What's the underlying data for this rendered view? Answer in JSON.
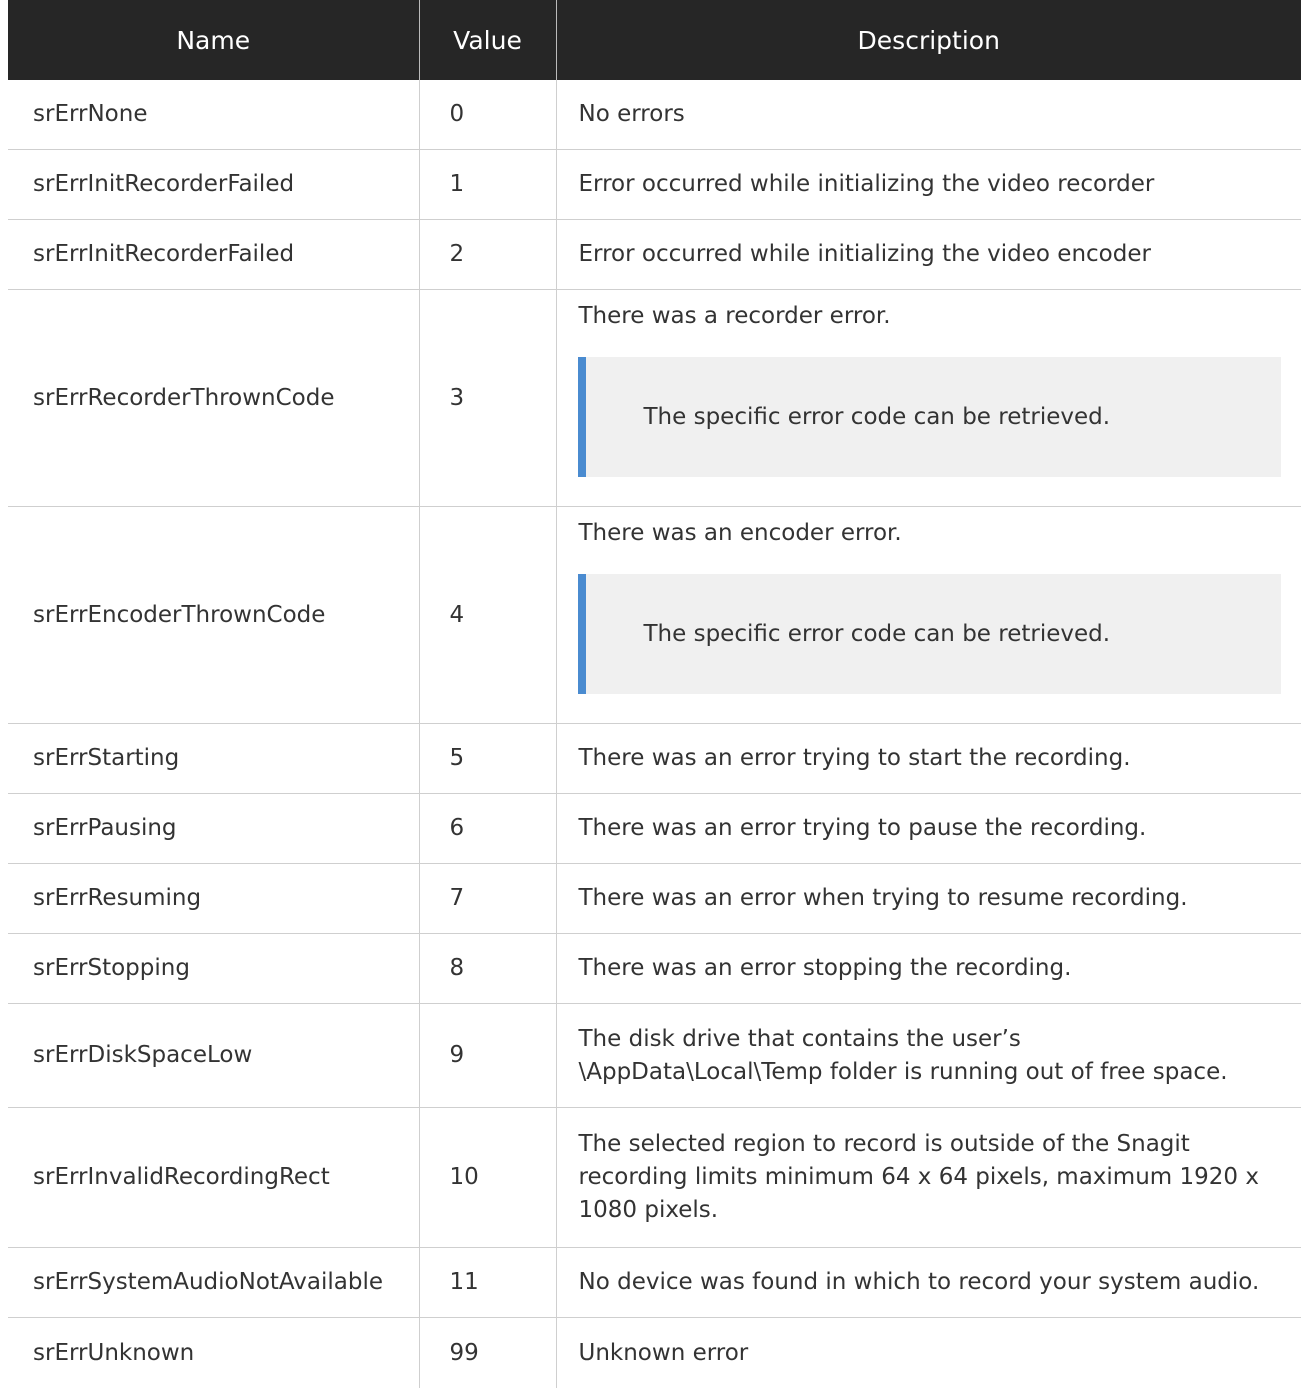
{
  "columns": [
    "Name",
    "Value",
    "Description"
  ],
  "rows": [
    {
      "name": "srErrNone",
      "value": "0",
      "description": "No errors"
    },
    {
      "name": "srErrInitRecorderFailed",
      "value": "1",
      "description": "Error occurred while initializing the video recorder"
    },
    {
      "name": "srErrInitRecorderFailed",
      "value": "2",
      "description": "Error occurred while initializing the video encoder"
    },
    {
      "name": "srErrRecorderThrownCode",
      "value": "3",
      "description": "There was a recorder error.",
      "note": "The specific error code can be retrieved."
    },
    {
      "name": "srErrEncoderThrownCode",
      "value": "4",
      "description": "There was an encoder error.",
      "note": "The specific error code can be retrieved."
    },
    {
      "name": "srErrStarting",
      "value": "5",
      "description": "There was an error trying to start the recording."
    },
    {
      "name": "srErrPausing",
      "value": "6",
      "description": "There was an error trying to pause the recording."
    },
    {
      "name": "srErrResuming",
      "value": "7",
      "description": "There was an error when trying to resume recording."
    },
    {
      "name": "srErrStopping",
      "value": "8",
      "description": "There was an error stopping the recording."
    },
    {
      "name": "srErrDiskSpaceLow",
      "value": "9",
      "description_lines": [
        "The disk drive that contains the user’s",
        "\\AppData\\Local\\Temp folder is running out of free space."
      ]
    },
    {
      "name": "srErrInvalidRecordingRect",
      "value": "10",
      "description_lines": [
        "The selected region to record is outside of the Snagit",
        "recording limits minimum 64 x 64 pixels, maximum 1920 x",
        "1080 pixels."
      ]
    },
    {
      "name": "srErrSystemAudioNotAvailable",
      "value": "11",
      "description": "No device was found in which to record your system audio."
    },
    {
      "name": "srErrUnknown",
      "value": "99",
      "description": "Unknown error"
    }
  ],
  "colors": {
    "header_background": "#262626",
    "header_text": "#ffffff",
    "note_accent": "#4a8bd0",
    "note_background": "#f0f0f0"
  }
}
